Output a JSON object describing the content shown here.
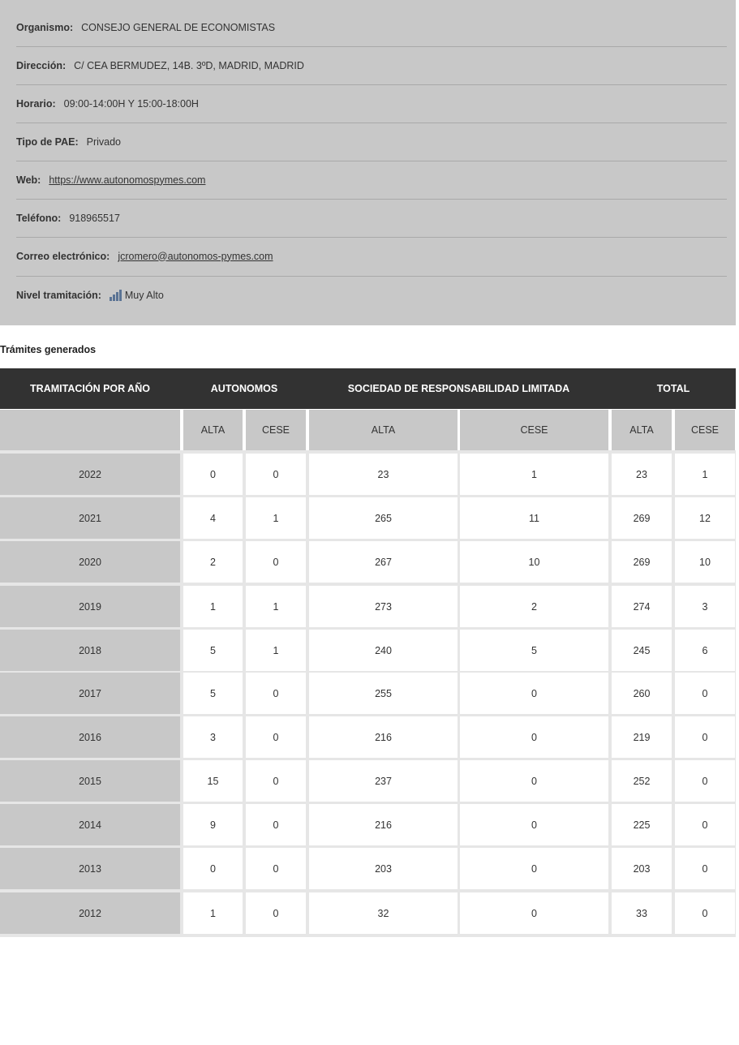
{
  "info": {
    "organismo": {
      "label": "Organismo:",
      "value": "CONSEJO GENERAL DE ECONOMISTAS"
    },
    "direccion": {
      "label": "Dirección:",
      "value": "C/ CEA BERMUDEZ, 14B. 3ºD, MADRID, MADRID"
    },
    "horario": {
      "label": "Horario:",
      "value": "09:00-14:00H Y 15:00-18:00H"
    },
    "tipo": {
      "label": "Tipo de PAE:",
      "value": "Privado"
    },
    "web": {
      "label": "Web:",
      "value": "https://www.autonomospymes.com"
    },
    "telefono": {
      "label": "Teléfono:",
      "value": "918965517"
    },
    "correo": {
      "label": "Correo electrónico:",
      "value": "jcromero@autonomos-pymes.com"
    },
    "nivel": {
      "label": "Nivel tramitación:",
      "value": "Muy Alto",
      "icon": "bar-chart-icon",
      "icon_color": "#5a7394"
    }
  },
  "section_title": "Trámites generados",
  "table": {
    "headers": [
      "TRAMITACIÓN POR AÑO",
      "AUTONOMOS",
      "SOCIEDAD DE RESPONSABILIDAD LIMITADA",
      "TOTAL"
    ],
    "subheaders": [
      "ALTA",
      "CESE",
      "ALTA",
      "CESE",
      "ALTA",
      "CESE"
    ],
    "rows": [
      [
        "2022",
        "0",
        "0",
        "23",
        "1",
        "23",
        "1"
      ],
      [
        "2021",
        "4",
        "1",
        "265",
        "11",
        "269",
        "12"
      ],
      [
        "2020",
        "2",
        "0",
        "267",
        "10",
        "269",
        "10"
      ],
      [
        "2019",
        "1",
        "1",
        "273",
        "2",
        "274",
        "3"
      ],
      [
        "2018",
        "5",
        "1",
        "240",
        "5",
        "245",
        "6"
      ],
      [
        "2017",
        "5",
        "0",
        "255",
        "0",
        "260",
        "0"
      ],
      [
        "2016",
        "3",
        "0",
        "216",
        "0",
        "219",
        "0"
      ],
      [
        "2015",
        "15",
        "0",
        "237",
        "0",
        "252",
        "0"
      ],
      [
        "2014",
        "9",
        "0",
        "216",
        "0",
        "225",
        "0"
      ],
      [
        "2013",
        "0",
        "0",
        "203",
        "0",
        "203",
        "0"
      ],
      [
        "2012",
        "1",
        "0",
        "32",
        "0",
        "33",
        "0"
      ]
    ]
  },
  "colors": {
    "header_bg": "#323232",
    "panel_bg": "#c8c8c8",
    "cell_bg": "#ffffff"
  }
}
